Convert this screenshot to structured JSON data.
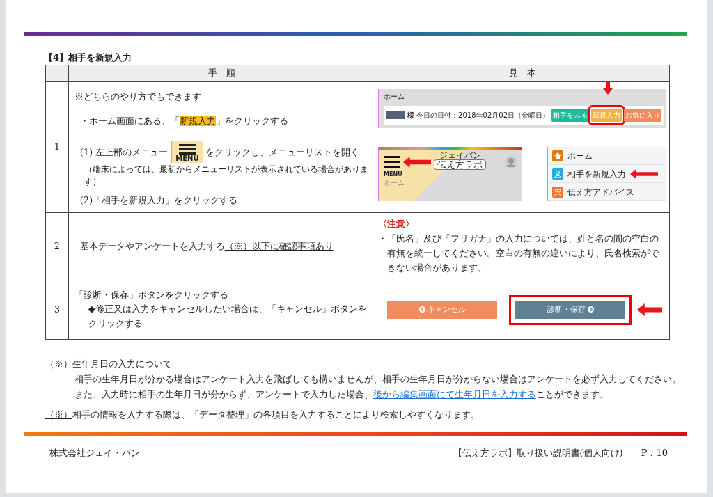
{
  "section_title": "【4】相手を新規入力",
  "table": {
    "columns": [
      "手　順",
      "見　本"
    ],
    "rows": [
      {
        "step": "1",
        "kind": "home",
        "lines": [
          "※どちらのやり方でもできます"
        ],
        "instruction": {
          "before": "・ホーム画面にある、「",
          "highlight": "新規入力",
          "after": "」をクリックする"
        },
        "sample": {
          "breadcrumb": "ホーム",
          "name_suffix": "様",
          "date_text": "今日の日付：2018年02月02日（金曜日）",
          "buttons": [
            {
              "label": "相手をみる",
              "color": "#1fb89a",
              "highlighted": false
            },
            {
              "label": "新規入力",
              "color": "#f5b04a",
              "highlighted": true
            },
            {
              "label": "お気に入り",
              "color": "#f28b5e",
              "highlighted": false
            }
          ]
        }
      },
      {
        "step": "",
        "kind": "menu",
        "item1": {
          "number": "(1)",
          "before": "左上部のメニュー",
          "icon_label": "MENU",
          "after": "をクリックし、メニューリストを開く",
          "note": "（端末によっては、最初からメニューリストが表示されている場合があります）"
        },
        "item2": {
          "number": "(2)",
          "text": "「相手を新規入力」をクリックする"
        },
        "sample": {
          "logo_ruby": "ジェイバン",
          "logo": "伝え方ラボ",
          "menu_label": "MENU",
          "breadcrumb": "ホーム",
          "menu_items": [
            {
              "label": "ホーム",
              "pointed": false
            },
            {
              "label": "相手を新規入力",
              "pointed": true
            },
            {
              "label": "伝え方アドバイス",
              "pointed": false
            }
          ]
        }
      },
      {
        "step": "2",
        "kind": "note",
        "instruction": "基本データやアンケートを入力する",
        "reference": "（※）以下に確認事項あり",
        "sample": {
          "title": "〈注意〉",
          "text": "・「氏名」及び「フリガナ」の入力については、姓と名の間の空白の有無を統一してください。空白の有無の違いにより、氏名検索ができない場合があります。"
        }
      },
      {
        "step": "3",
        "kind": "buttons",
        "instruction": "「診断・保存」ボタンをクリックする",
        "sub": "◆修正又は入力をキャンセルしたい場合は、「キャンセル」ボタンをクリックする",
        "sample": {
          "buttons": [
            {
              "label": "キャンセル",
              "kind": "cancel",
              "highlighted": false
            },
            {
              "label": "診断・保存",
              "kind": "save",
              "highlighted": true
            }
          ]
        }
      }
    ]
  },
  "notes": [
    {
      "mark": "（※）",
      "title": "生年月日の入力について",
      "paragraphs": [
        {
          "text": "相手の生年月日が分かる場合はアンケート入力を飛ばしても構いませんが、相手の生年月日が分からない場合はアンケートを必ず入力してください。"
        },
        {
          "text": "また、入力時に相手の生年月日が分からず、アンケートで入力した場合、",
          "link": "後から編集画面にて生年月日を入力する",
          "after": "ことができます。"
        }
      ]
    },
    {
      "mark": "（※）",
      "title": "相手の情報を入力する際は、「データ整理」の各項目を入力することにより検索しやすくなります。"
    }
  ],
  "footer": {
    "company": "株式会社ジェイ・バン",
    "manual": "【伝え方ラボ】取り扱い説明書(個人向け)",
    "page": "P．10"
  }
}
